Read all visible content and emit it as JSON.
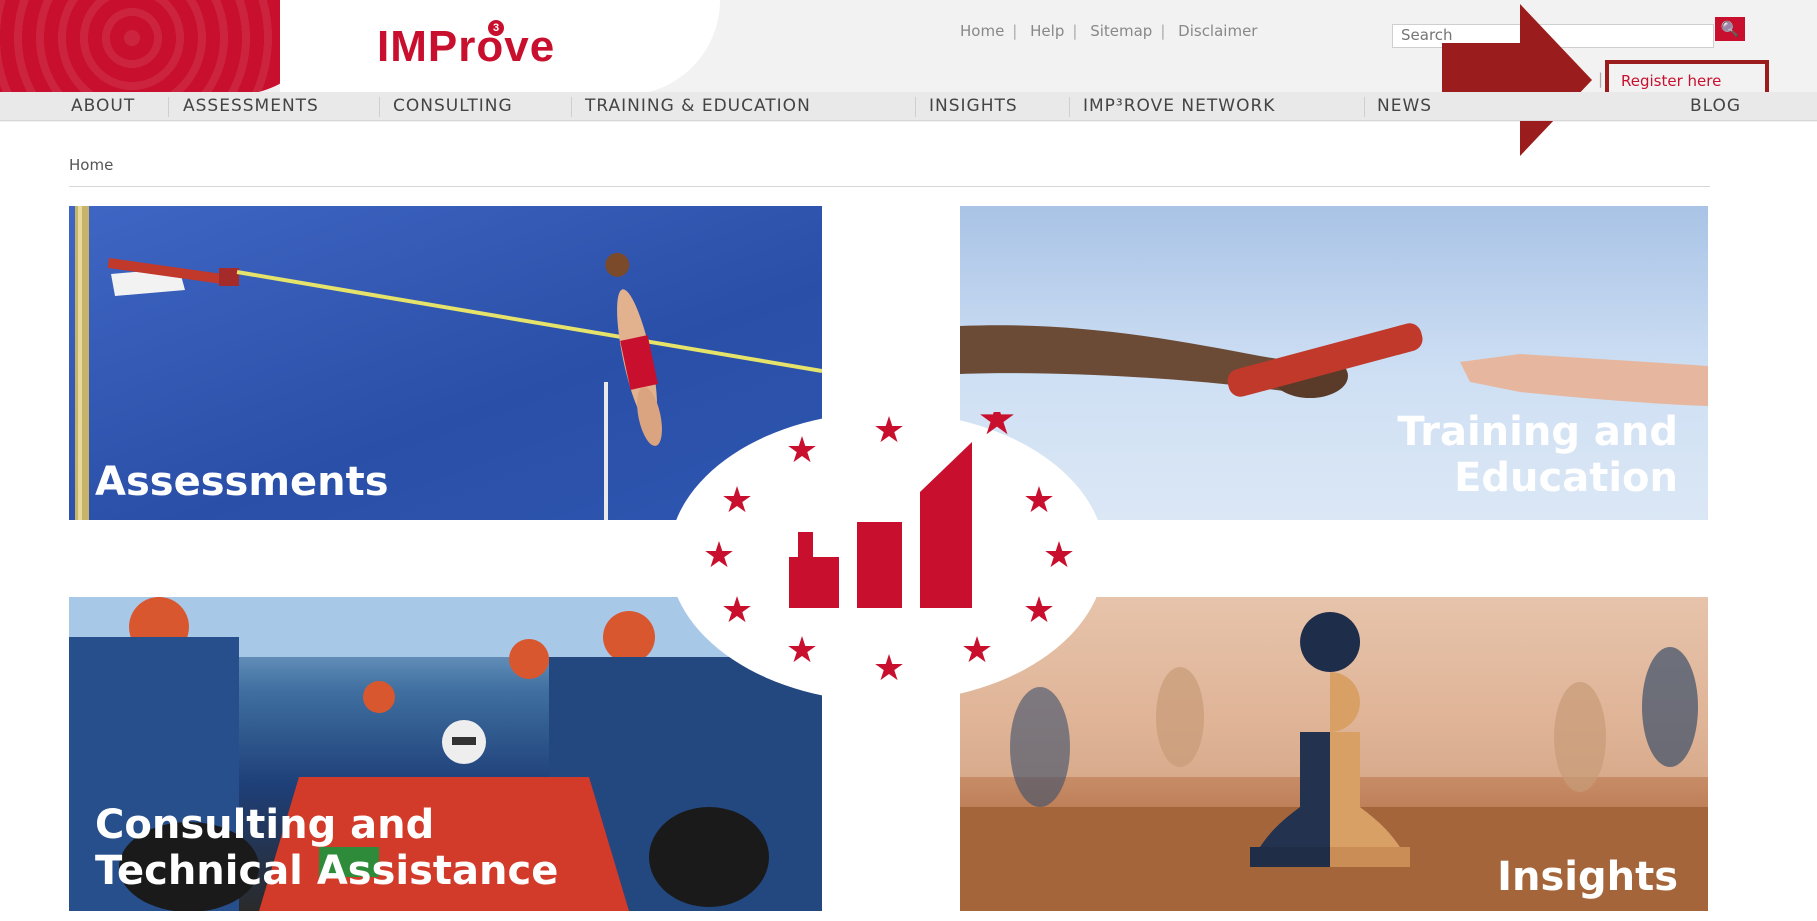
{
  "header": {
    "logo_text": "IMProve",
    "logo_sup": "3",
    "links": [
      "Home",
      "Help",
      "Sitemap",
      "Disclaimer"
    ],
    "search_placeholder": "Search",
    "register_label": "Register here"
  },
  "nav": {
    "items": [
      "ABOUT",
      "ASSESSMENTS",
      "CONSULTING",
      "TRAINING & EDUCATION",
      "INSIGHTS",
      "IMP³ROVE NETWORK",
      "NEWS",
      "BLOG"
    ]
  },
  "breadcrumb": "Home",
  "tiles": [
    {
      "title_line1": "Assessments",
      "title_line2": ""
    },
    {
      "title_line1": "Training and",
      "title_line2": "Education"
    },
    {
      "title_line1": "Consulting and",
      "title_line2": "Technical Assistance"
    },
    {
      "title_line1": "Insights",
      "title_line2": ""
    }
  ],
  "colors": {
    "brand_red": "#c8102e",
    "annotation_red": "#9b1c1c"
  },
  "icons": [
    "search-icon",
    "red-arrow-annotation",
    "eu-stars-logo"
  ]
}
